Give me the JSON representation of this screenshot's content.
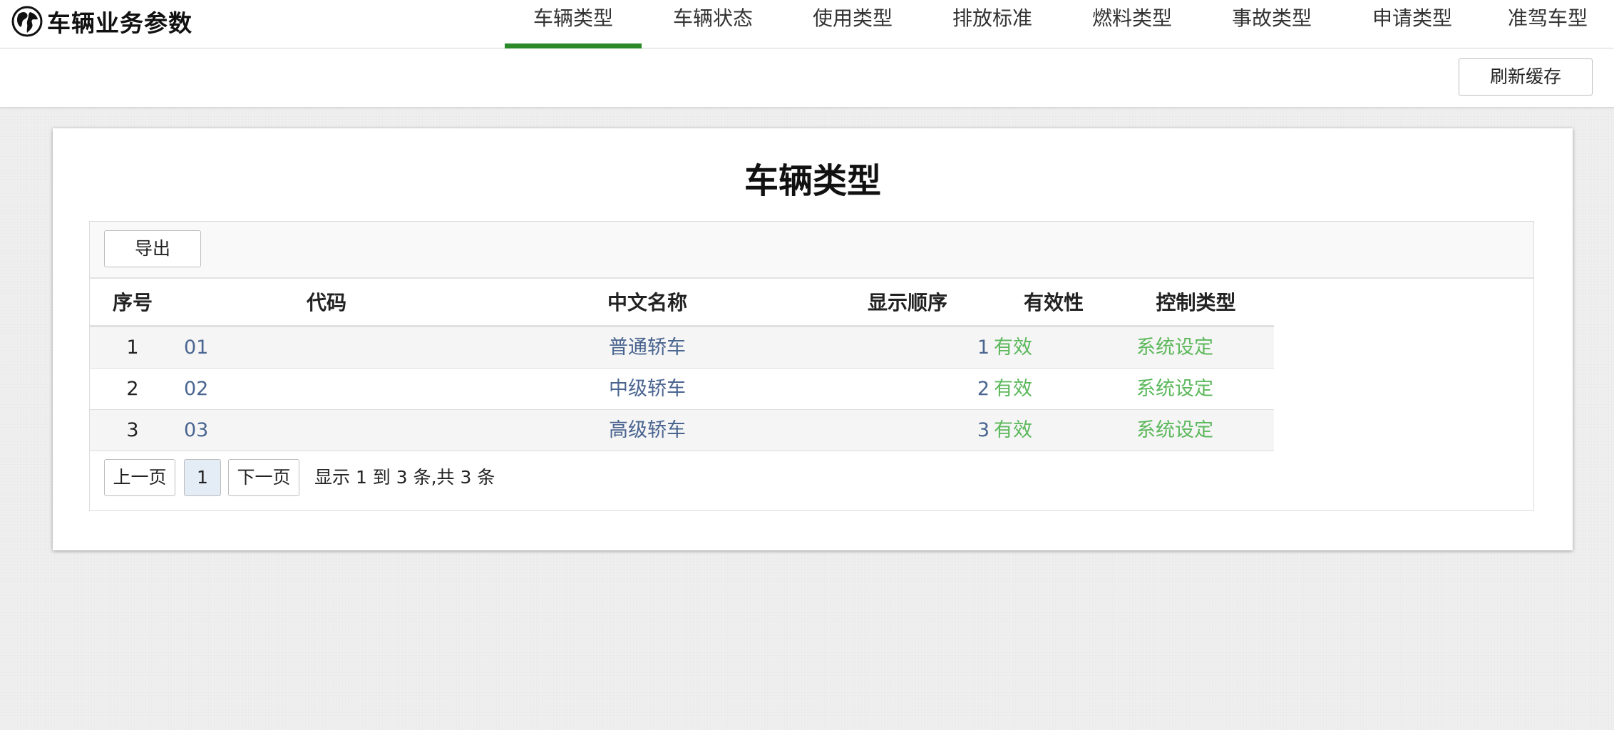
{
  "app": {
    "title": "车辆业务参数",
    "logo_icon": "globe-icon"
  },
  "nav": {
    "tabs": [
      {
        "label": "车辆类型",
        "active": true
      },
      {
        "label": "车辆状态",
        "active": false
      },
      {
        "label": "使用类型",
        "active": false
      },
      {
        "label": "排放标准",
        "active": false
      },
      {
        "label": "燃料类型",
        "active": false
      },
      {
        "label": "事故类型",
        "active": false
      },
      {
        "label": "申请类型",
        "active": false
      },
      {
        "label": "准驾车型",
        "active": false
      }
    ],
    "active_color": "#2a8a2a"
  },
  "toolbar": {
    "refresh_label": "刷新缓存"
  },
  "main": {
    "title": "车辆类型",
    "export_label": "导出",
    "table": {
      "columns": [
        "序号",
        "代码",
        "中文名称",
        "显示顺序",
        "有效性",
        "控制类型"
      ],
      "rows": [
        {
          "index": "1",
          "code": "01",
          "name": "普通轿车",
          "order": "1",
          "validity": "有效",
          "control": "系统设定"
        },
        {
          "index": "2",
          "code": "02",
          "name": "中级轿车",
          "order": "2",
          "validity": "有效",
          "control": "系统设定"
        },
        {
          "index": "3",
          "code": "03",
          "name": "高级轿车",
          "order": "3",
          "validity": "有效",
          "control": "系统设定"
        }
      ]
    },
    "pagination": {
      "prev_label": "上一页",
      "current_page": "1",
      "next_label": "下一页",
      "info": "显示 1 到 3 条,共 3 条"
    }
  },
  "colors": {
    "link": "#4a6590",
    "status_green": "#5cb85c",
    "current_page_bg": "#e4ecf6"
  }
}
